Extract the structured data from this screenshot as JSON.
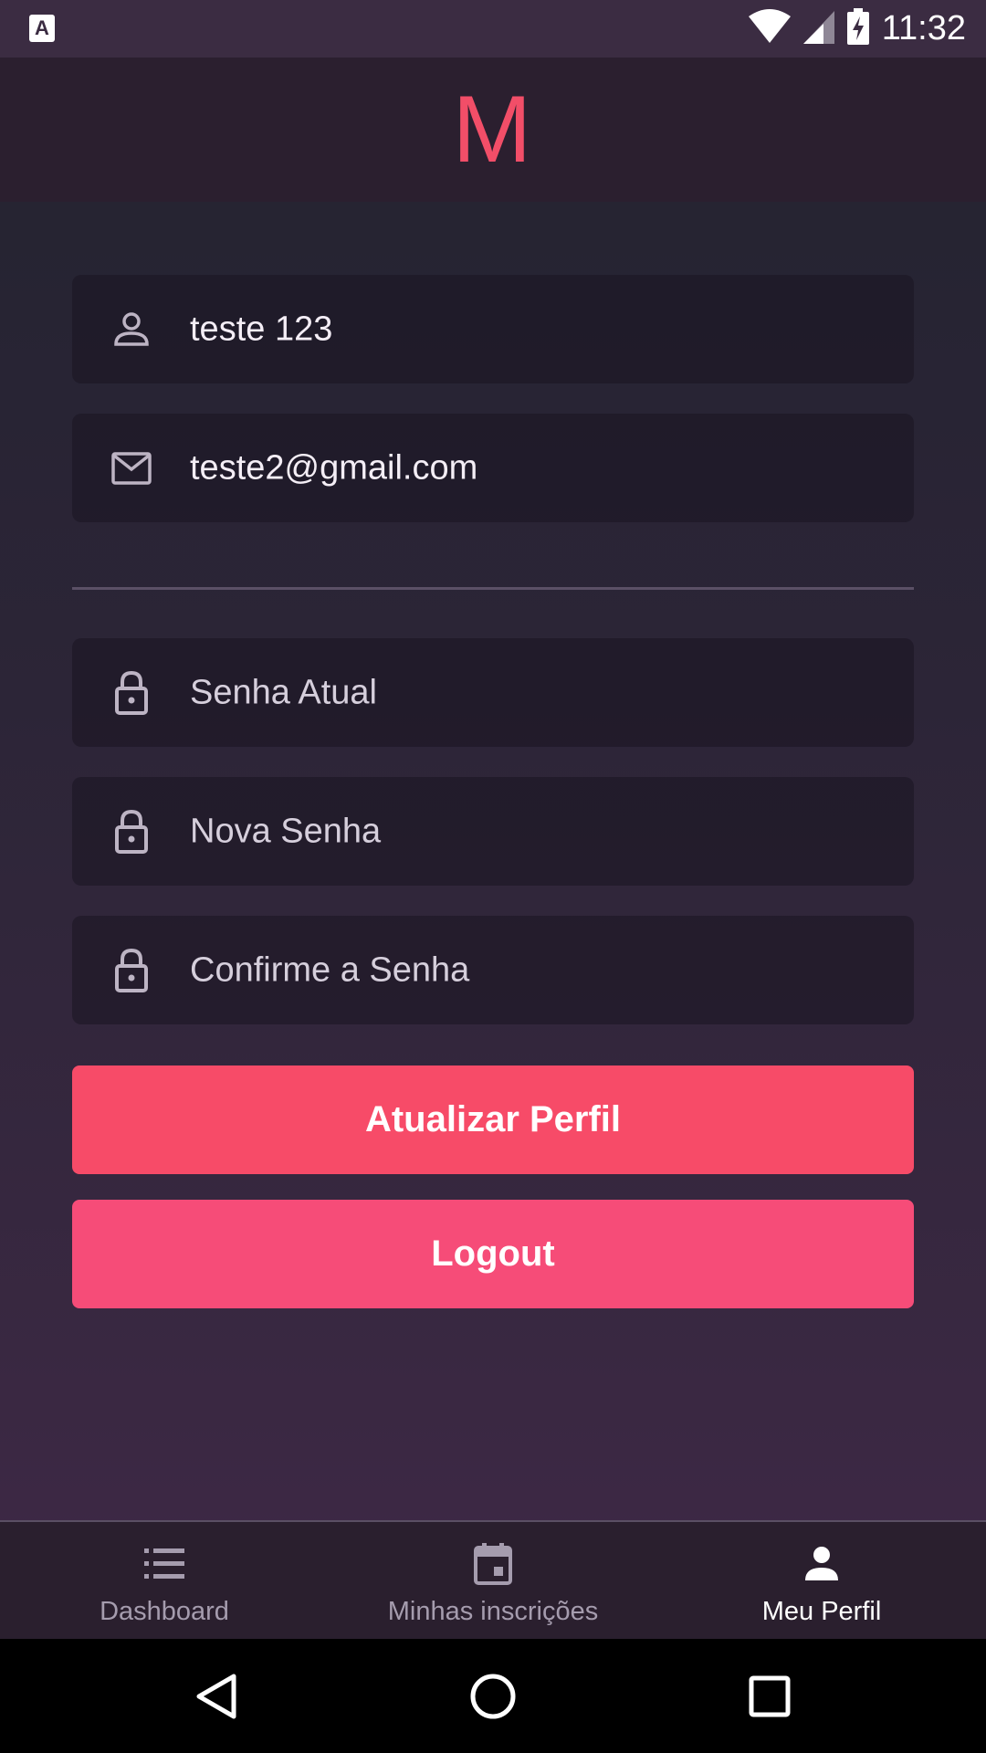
{
  "status_bar": {
    "time": "11:32",
    "notification_icon": "A"
  },
  "header": {
    "logo": "M",
    "logo_color": "#f24e68"
  },
  "form": {
    "name_value": "teste 123",
    "email_value": "teste2@gmail.com",
    "current_password_placeholder": "Senha Atual",
    "new_password_placeholder": "Nova Senha",
    "confirm_password_placeholder": "Confirme a Senha",
    "icons": [
      "user-icon",
      "mail-icon",
      "lock-icon",
      "lock-icon",
      "lock-icon"
    ]
  },
  "buttons": {
    "update_label": "Atualizar Perfil",
    "logout_label": "Logout",
    "accent_color": "#f74b68"
  },
  "tabs": [
    {
      "label": "Dashboard",
      "icon": "list-icon",
      "active": false
    },
    {
      "label": "Minhas inscrições",
      "icon": "calendar-icon",
      "active": false
    },
    {
      "label": "Meu Perfil",
      "icon": "person-icon",
      "active": true
    }
  ],
  "nav": {
    "icons": [
      "back-icon",
      "home-icon",
      "recents-icon"
    ]
  }
}
